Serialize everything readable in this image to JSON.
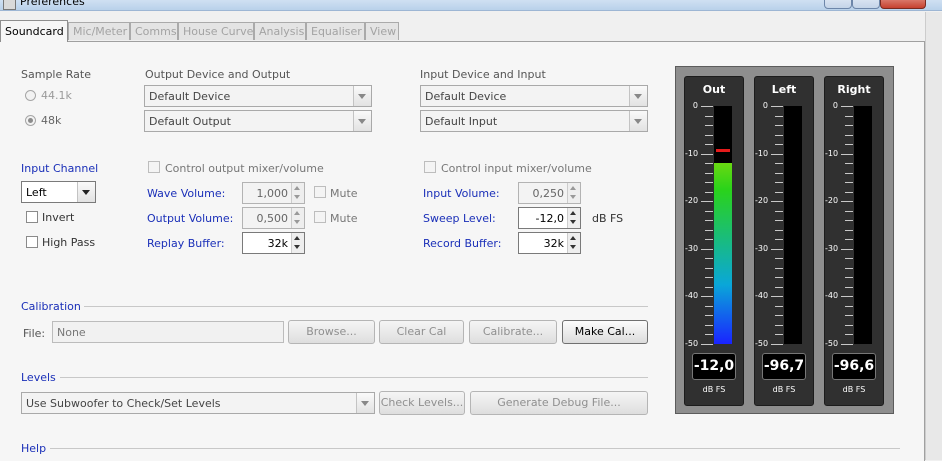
{
  "window": {
    "title": "Preferences"
  },
  "tabs": [
    {
      "label": "Soundcard",
      "active": true
    },
    {
      "label": "Mic/Meter",
      "active": false
    },
    {
      "label": "Comms",
      "active": false
    },
    {
      "label": "House Curve",
      "active": false
    },
    {
      "label": "Analysis",
      "active": false
    },
    {
      "label": "Equaliser",
      "active": false
    },
    {
      "label": "View",
      "active": false
    }
  ],
  "sample_rate": {
    "label": "Sample Rate",
    "options": [
      {
        "label": "44.1k",
        "selected": false
      },
      {
        "label": "48k",
        "selected": true
      }
    ]
  },
  "output": {
    "heading": "Output Device and Output",
    "device": "Default Device",
    "output": "Default Output",
    "mixer_label": "Control output mixer/volume",
    "wave_volume_label": "Wave Volume:",
    "wave_volume": "1,000",
    "output_volume_label": "Output Volume:",
    "output_volume": "0,500",
    "mute_label": "Mute",
    "replay_buffer_label": "Replay Buffer:",
    "replay_buffer": "32k"
  },
  "input": {
    "heading": "Input Device and Input",
    "device": "Default Device",
    "input": "Default Input",
    "mixer_label": "Control input mixer/volume",
    "input_volume_label": "Input Volume:",
    "input_volume": "0,250",
    "sweep_level_label": "Sweep Level:",
    "sweep_level": "-12,0",
    "sweep_unit": "dB FS",
    "record_buffer_label": "Record Buffer:",
    "record_buffer": "32k"
  },
  "input_channel": {
    "label": "Input Channel",
    "value": "Left",
    "invert_label": "Invert",
    "highpass_label": "High Pass"
  },
  "calibration": {
    "heading": "Calibration",
    "file_label": "File:",
    "file_value": "None",
    "browse": "Browse...",
    "clear": "Clear Cal",
    "calibrate": "Calibrate...",
    "make": "Make Cal..."
  },
  "levels": {
    "heading": "Levels",
    "mode": "Use Subwoofer to Check/Set Levels",
    "check": "Check Levels...",
    "debug": "Generate Debug File..."
  },
  "help": {
    "heading": "Help"
  },
  "meters": {
    "scale_labels": [
      "0",
      "-10",
      "-20",
      "-30",
      "-40",
      "-50"
    ],
    "unit": "dB FS",
    "items": [
      {
        "name": "Out",
        "readout": "-12,0",
        "level_db": -12.0,
        "peak_db": -9.0
      },
      {
        "name": "Left",
        "readout": "-96,7",
        "level_db": -96.7,
        "peak_db": null
      },
      {
        "name": "Right",
        "readout": "-96,6",
        "level_db": -96.6,
        "peak_db": null
      }
    ]
  },
  "colors": {
    "label_blue": "#1a2fb8",
    "meter_bg": "#303030",
    "peak_red": "#e51b1b"
  }
}
